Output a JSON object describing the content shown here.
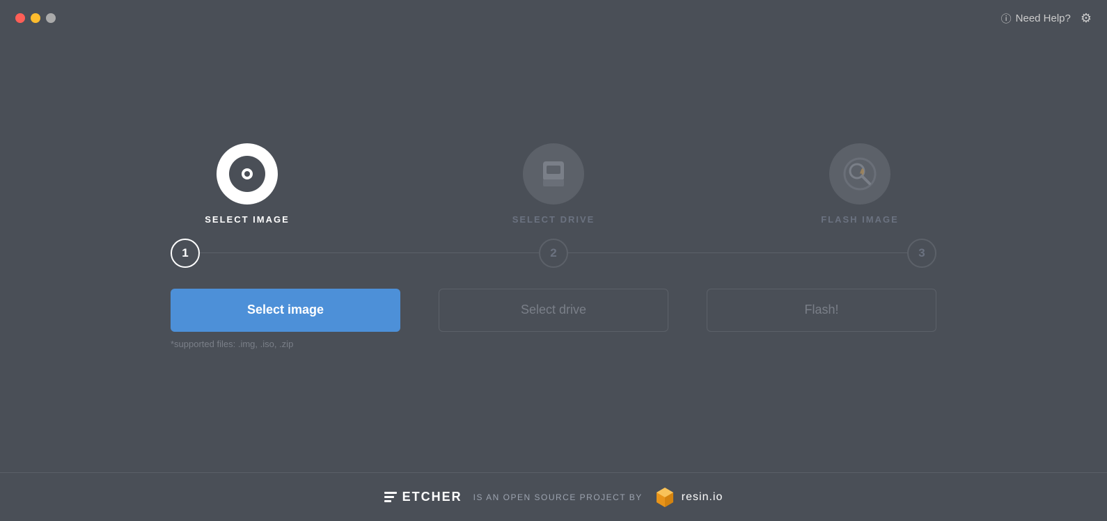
{
  "titlebar": {
    "help_label": "Need Help?",
    "traffic_lights": [
      "close",
      "minimize",
      "maximize"
    ]
  },
  "steps": [
    {
      "id": "select-image",
      "label": "SELECT IMAGE",
      "number": "1",
      "state": "active"
    },
    {
      "id": "select-drive",
      "label": "SELECT DRIVE",
      "number": "2",
      "state": "inactive"
    },
    {
      "id": "flash-image",
      "label": "FLASH IMAGE",
      "number": "3",
      "state": "inactive"
    }
  ],
  "buttons": {
    "select_image": "Select image",
    "select_drive": "Select drive",
    "flash": "Flash!"
  },
  "supported_files": "*supported files: .img, .iso, .zip",
  "footer": {
    "open_source_text": "IS AN OPEN SOURCE PROJECT BY",
    "resin_text": "resin.io"
  }
}
